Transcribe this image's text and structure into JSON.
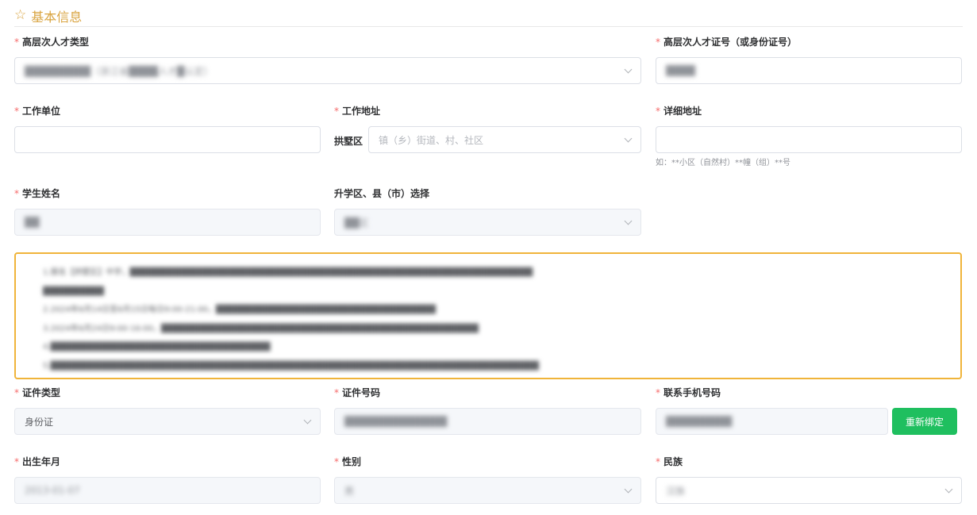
{
  "section": {
    "star_glyph": "☆",
    "title": "基本信息",
    "accent_color": "#d9a441"
  },
  "required_mark": "*",
  "fields": {
    "talent_type": {
      "label": "高层次人才类型",
      "value": "█████████（浙江省████人才█认定）"
    },
    "talent_cert_no": {
      "label": "高层次人才证号（或身份证号）",
      "value": "████"
    },
    "work_unit": {
      "label": "工作单位",
      "value": ""
    },
    "work_address": {
      "label": "工作地址",
      "prefix": "拱墅区",
      "placeholder": "镇（乡）街道、村、社区"
    },
    "detail_address": {
      "label": "详细地址",
      "value": "",
      "hint": "如：**小区（自然村）**幢（组）**号"
    },
    "student_name": {
      "label": "学生姓名",
      "value": "██"
    },
    "school_district": {
      "label": "升学区、县（市）选择",
      "value": "██区"
    },
    "id_type": {
      "label": "证件类型",
      "value": "身份证"
    },
    "id_number": {
      "label": "证件号码",
      "value": "██████████████"
    },
    "phone": {
      "label": "联系手机号码",
      "value": "█████████"
    },
    "birth_date": {
      "label": "出生年月",
      "value": "2013-01-07"
    },
    "gender": {
      "label": "性别",
      "value": "男"
    },
    "ethnicity": {
      "label": "民族",
      "value": "汉族"
    }
  },
  "rebind_button": {
    "label": "重新绑定",
    "color": "#1fbf5f"
  },
  "notice": {
    "border_color": "#f0b43a",
    "lines": [
      "1.报名【拱墅区】中学，██████████████████████████████████████████████████████████████████",
      "██████████",
      "2.2024年6月14日至6月15日每日9:00-21:00，████████████████████████████████████",
      "3.2024年6月24日9:00-16:00，████████████████████████████████████████████████████",
      "4.████████████████████████████████████",
      "5.████████████████████████████████████████████████████████████████████████████████"
    ]
  }
}
